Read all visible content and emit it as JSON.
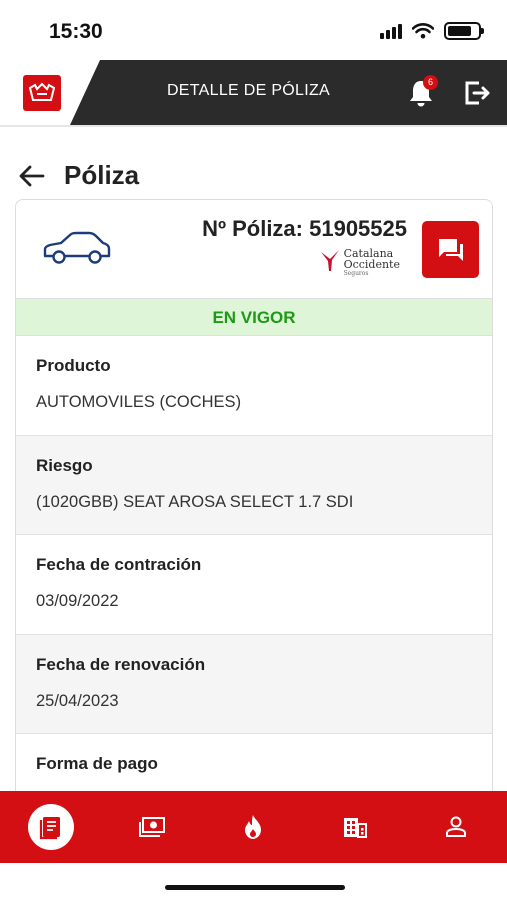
{
  "status_bar": {
    "time": "15:30"
  },
  "header": {
    "title": "DETALLE DE PÓLIZA",
    "notifications_count": "6"
  },
  "page": {
    "title": "Póliza"
  },
  "policy": {
    "number_label": "Nº Póliza: 51905525",
    "insurer_line1": "Catalana",
    "insurer_line2": "Occidente",
    "insurer_line3": "Seguros",
    "status": "EN VIGOR",
    "fields": [
      {
        "label": "Producto",
        "value": "AUTOMOVILES (COCHES)"
      },
      {
        "label": "Riesgo",
        "value": "(1020GBB) SEAT AROSA SELECT 1.7 SDI"
      },
      {
        "label": "Fecha de contración",
        "value": "03/09/2022"
      },
      {
        "label": "Fecha de renovación",
        "value": "25/04/2023"
      },
      {
        "label": "Forma de pago",
        "value": ""
      }
    ]
  },
  "bottom_nav": [
    {
      "icon": "policies-icon",
      "active": true
    },
    {
      "icon": "receipts-icon",
      "active": false
    },
    {
      "icon": "claims-icon",
      "active": false
    },
    {
      "icon": "offices-icon",
      "active": false
    },
    {
      "icon": "profile-icon",
      "active": false
    }
  ],
  "colors": {
    "brand_red": "#d40f14",
    "header_dark": "#2b2b2b",
    "status_green": "#1f9a18",
    "status_bg": "#dff5d7"
  }
}
